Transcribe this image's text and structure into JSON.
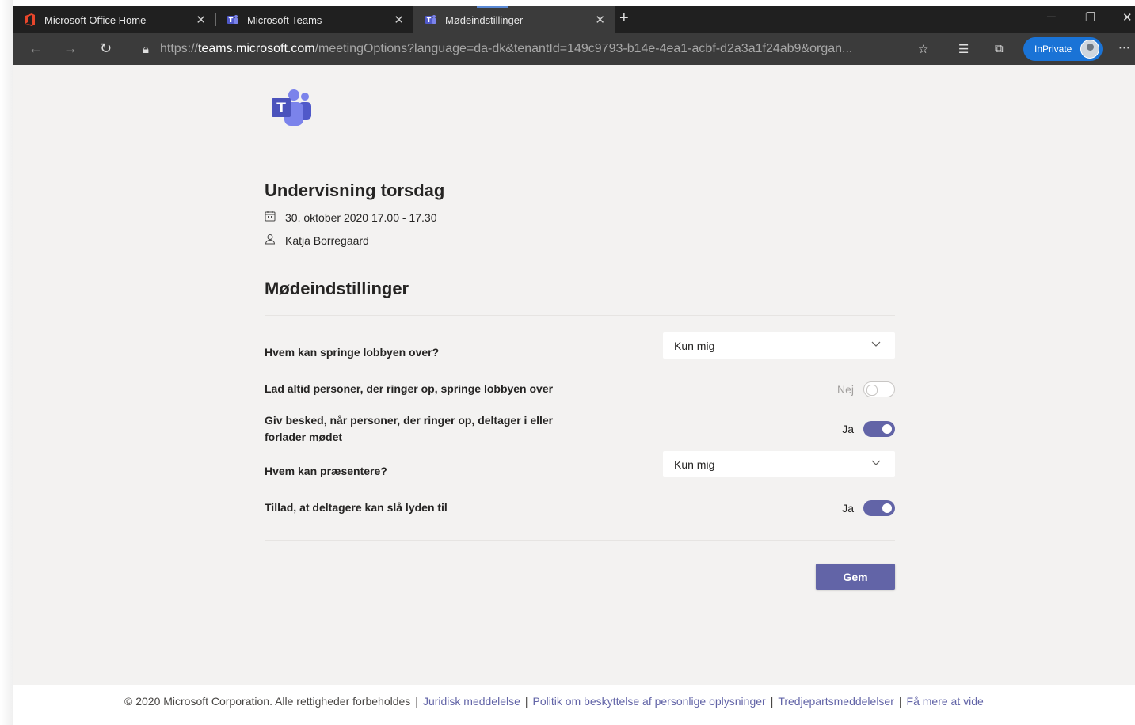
{
  "browser": {
    "tabs": [
      {
        "title": "Microsoft Office Home",
        "icon": "office-icon",
        "active": false
      },
      {
        "title": "Microsoft Teams",
        "icon": "teams-icon",
        "active": false
      },
      {
        "title": "Mødeindstillinger",
        "icon": "teams-icon",
        "active": true
      }
    ],
    "url_scheme": "https://",
    "url_domain": "teams.microsoft.com",
    "url_rest": "/meetingOptions?language=da-dk&tenantId=149c9793-b14e-4ea1-acbf-d2a3a1f24ab9&organ...",
    "inprivate_label": "InPrivate",
    "accent": "#1a73d6"
  },
  "meeting": {
    "title": "Undervisning torsdag",
    "datetime": "30. oktober 2020 17.00 - 17.30",
    "organizer": "Katja Borregaard"
  },
  "settings": {
    "heading": "Mødeindstillinger",
    "lobby_bypass": {
      "label": "Hvem kan springe lobbyen over?",
      "value": "Kun mig"
    },
    "dialin_bypass": {
      "label": "Lad altid personer, der ringer op, springe lobbyen over",
      "state_text": "Nej",
      "on": false
    },
    "notify_dialin": {
      "label_line1": "Giv besked, når personer, der ringer op, deltager i eller",
      "label_line2": "forlader mødet",
      "state_text": "Ja",
      "on": true
    },
    "presenters": {
      "label": "Hvem kan præsentere?",
      "value": "Kun mig"
    },
    "allow_unmute": {
      "label": "Tillad, at deltagere kan slå lyden til",
      "state_text": "Ja",
      "on": true
    },
    "save_label": "Gem",
    "accent": "#6264a7"
  },
  "footer": {
    "copyright": "© 2020 Microsoft Corporation. Alle rettigheder forbeholdes",
    "links": [
      "Juridisk meddelelse",
      "Politik om beskyttelse af personlige oplysninger",
      "Tredjepartsmeddelelser",
      "Få mere at vide"
    ]
  }
}
